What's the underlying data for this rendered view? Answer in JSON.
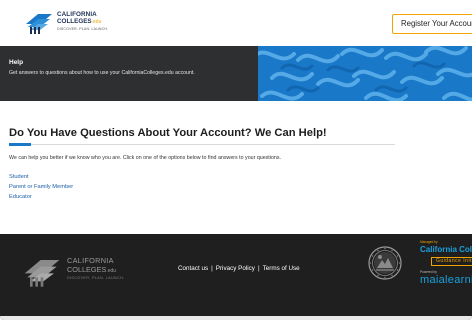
{
  "header": {
    "logo": {
      "line1": "CALIFORNIA",
      "line2": "COLLEGES",
      "edu": ".edu",
      "tagline": "DISCOVER. PLAN. LAUNCH."
    },
    "register_label": "Register Your Account"
  },
  "banner": {
    "title": "Help",
    "description": "Get answers to questions about how to use your CaliforniaColleges.edu account."
  },
  "main": {
    "title": "Do You Have Questions About Your Account? We Can Help!",
    "intro": "We can help you better if we know who you are. Click on one of the options below to find answers to your questions.",
    "options": [
      "Student",
      "Parent or Family Member",
      "Educator"
    ]
  },
  "footer": {
    "logo": {
      "line1": "CALIFORNIA",
      "line2": "COLLEGES",
      "edu": ".edu",
      "tagline": "DISCOVER. PLAN. LAUNCH."
    },
    "links": {
      "contact": "Contact us",
      "privacy": "Privacy Policy",
      "terms": "Terms of Use",
      "separator": "|"
    },
    "managed_by": "Managed by",
    "cc_name": "California Colleges",
    "guidance": "Guidance Initiative",
    "powered_by": "Powered by",
    "maia": "maialearning"
  },
  "colors": {
    "brand_navy": "#1d3054",
    "accent_gold": "#f0a500",
    "link_blue": "#1b5fa8",
    "banner_blue": "#1a78c8",
    "footer_bg": "#1f1f1f"
  }
}
